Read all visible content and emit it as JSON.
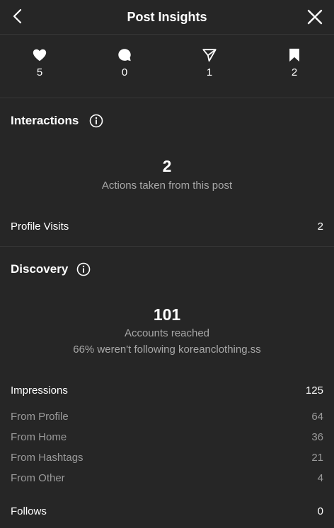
{
  "header": {
    "title": "Post Insights"
  },
  "stats": [
    {
      "icon": "heart-icon",
      "value": "5"
    },
    {
      "icon": "comment-icon",
      "value": "0"
    },
    {
      "icon": "share-icon",
      "value": "1"
    },
    {
      "icon": "bookmark-icon",
      "value": "2"
    }
  ],
  "interactions": {
    "title": "Interactions",
    "total": "2",
    "caption": "Actions taken from this post",
    "rows": [
      {
        "label": "Profile Visits",
        "value": "2"
      }
    ]
  },
  "discovery": {
    "title": "Discovery",
    "reached": "101",
    "reached_caption": "Accounts reached",
    "following_note": "66% weren't following koreanclothing.ss",
    "impressions": {
      "label": "Impressions",
      "value": "125"
    },
    "sources": [
      {
        "label": "From Profile",
        "value": "64"
      },
      {
        "label": "From Home",
        "value": "36"
      },
      {
        "label": "From Hashtags",
        "value": "21"
      },
      {
        "label": "From Other",
        "value": "4"
      }
    ],
    "follows": {
      "label": "Follows",
      "value": "0"
    }
  },
  "colors": {
    "background": "#262626",
    "text": "#ffffff",
    "muted": "#a8a8a8",
    "divider": "#363636"
  }
}
